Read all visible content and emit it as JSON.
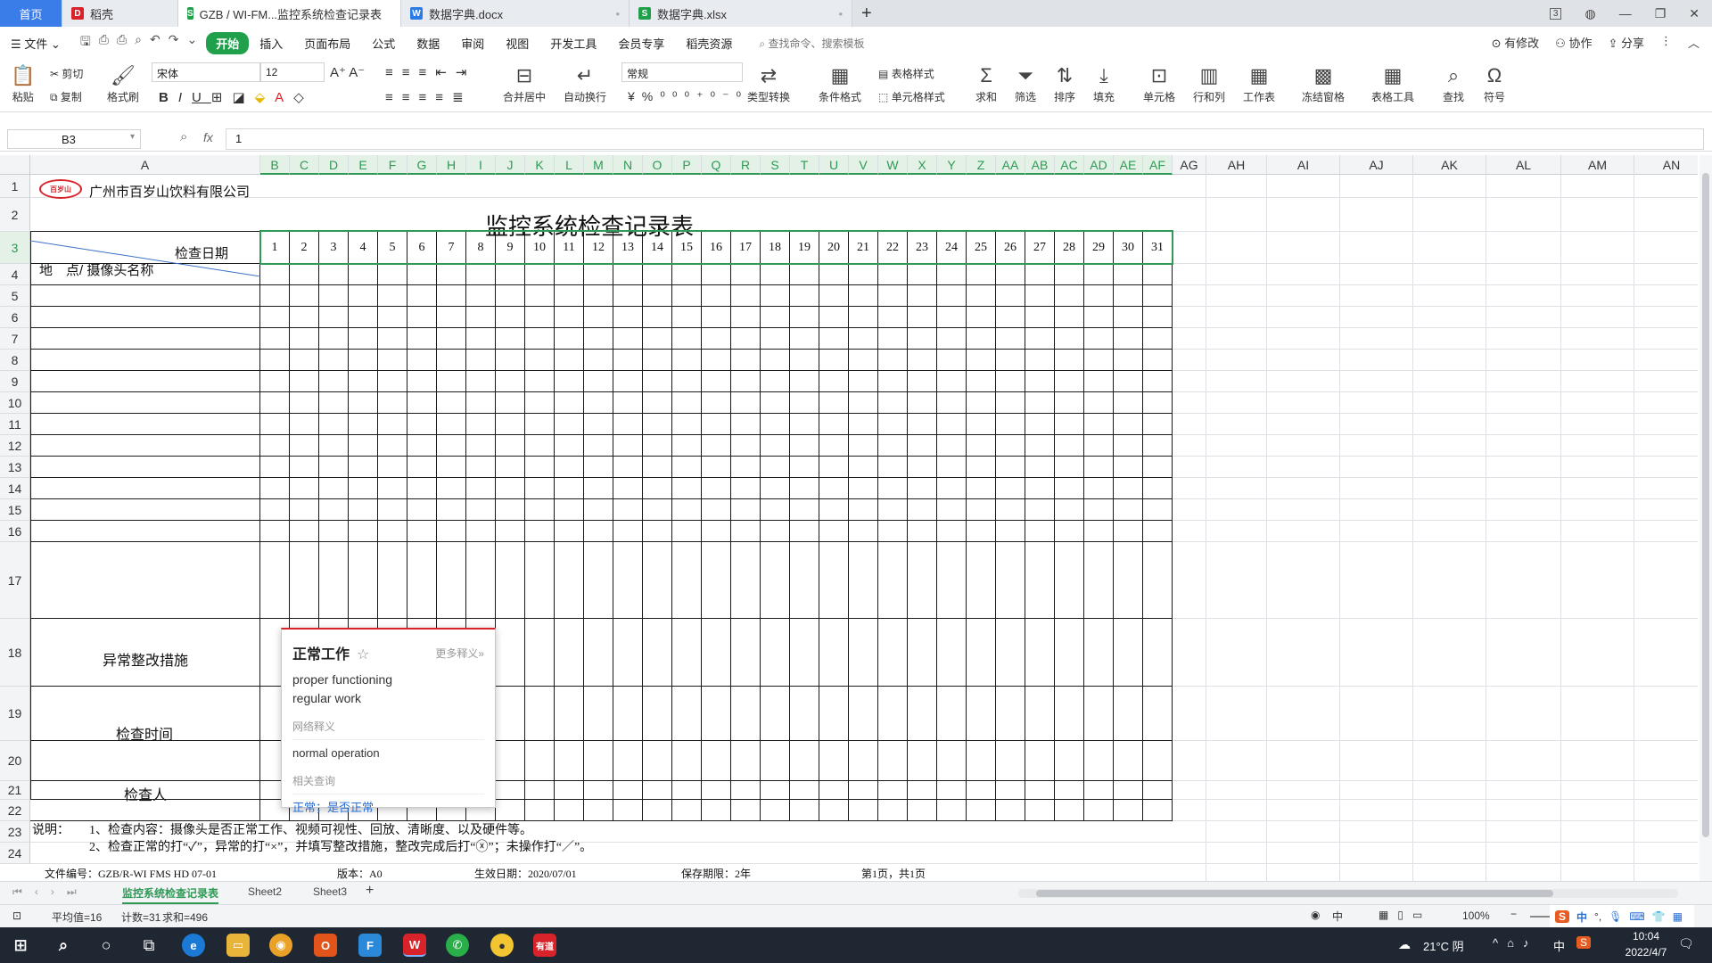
{
  "tabs": [
    {
      "label": "首页",
      "type": "home"
    },
    {
      "label": "稻壳",
      "icon": "docer-icon",
      "color": "#d8232a"
    },
    {
      "label": "GZB / WI-FM...监控系统检查记录表",
      "icon": "sheet-icon",
      "color": "#20a04a",
      "active": true
    },
    {
      "label": "数据字典.docx",
      "icon": "word-icon",
      "color": "#2b7be5"
    },
    {
      "label": "数据字典.xlsx",
      "icon": "sheet-icon",
      "color": "#20a04a"
    }
  ],
  "new_tab": "+",
  "window_badge": "3",
  "menu": {
    "file": "文件",
    "items": [
      "开始",
      "插入",
      "页面布局",
      "公式",
      "数据",
      "审阅",
      "视图",
      "开发工具",
      "会员专享",
      "稻壳资源"
    ],
    "active": "开始",
    "search": "查找命令、搜索模板",
    "right": [
      "有修改",
      "协作",
      "分享"
    ]
  },
  "ribbon": {
    "paste": "粘贴",
    "cut": "剪切",
    "copy": "复制",
    "format_painter": "格式刷",
    "font": "宋体",
    "font_size": "12",
    "merge": "合并居中",
    "wrap": "自动换行",
    "number_format": "常规",
    "convert": "类型转换",
    "cond_format": "条件格式",
    "table_style": "表格样式",
    "cell_style": "单元格样式",
    "sum": "求和",
    "filter": "筛选",
    "sort": "排序",
    "fill": "填充",
    "cell": "单元格",
    "rowcol": "行和列",
    "worksheet": "工作表",
    "freeze": "冻结窗格",
    "table_tools": "表格工具",
    "find": "查找",
    "symbol": "符号"
  },
  "formula_bar": {
    "cell": "B3",
    "fx": "fx",
    "value": "1"
  },
  "columns": {
    "A": "A",
    "date_cols": [
      "B",
      "C",
      "D",
      "E",
      "F",
      "G",
      "H",
      "I",
      "J",
      "K",
      "L",
      "M",
      "N",
      "O",
      "P",
      "Q",
      "R",
      "S",
      "T",
      "U",
      "V",
      "W",
      "X",
      "Y",
      "Z",
      "AA",
      "AB",
      "AC",
      "AD",
      "AE",
      "AF"
    ],
    "extra": [
      "AG",
      "AH",
      "AI",
      "AJ",
      "AK",
      "AL",
      "AM",
      "AN"
    ]
  },
  "rows": [
    "1",
    "2",
    "3",
    "4",
    "5",
    "6",
    "7",
    "8",
    "9",
    "10",
    "11",
    "12",
    "13",
    "14",
    "15",
    "16",
    "17",
    "18",
    "19",
    "20",
    "21",
    "22",
    "23",
    "24"
  ],
  "sheet": {
    "company": "广州市百岁山饮料有限公司",
    "logo_text": "百岁山",
    "title": "监控系统检查记录表",
    "header_date": "检查日期",
    "header_place": "地　点/ 摄像头名称",
    "days": [
      "1",
      "2",
      "3",
      "4",
      "5",
      "6",
      "7",
      "8",
      "9",
      "10",
      "11",
      "12",
      "13",
      "14",
      "15",
      "16",
      "17",
      "18",
      "19",
      "20",
      "21",
      "22",
      "23",
      "24",
      "25",
      "26",
      "27",
      "28",
      "29",
      "30",
      "31"
    ],
    "row20": "异常整改措施",
    "row21": "检查时间",
    "row22": "检查人",
    "note_label": "说明：",
    "note1": "1、检查内容：摄像头是否正常工作、视频可视性、回放、清晰度、以及硬件等。",
    "note2": "2、检查正常的打“✓”，异常的打“×”，并填写整改措施，整改完成后打“ⓧ”；未操作打“／”。",
    "footer": {
      "doc_no": "文件编号：GZB/R-WI FMS HD 07-01",
      "version": "版本：A0",
      "effective": "生效日期：2020/07/01",
      "retention": "保存期限：2年",
      "page": "第1页，共1页"
    }
  },
  "popup": {
    "word": "正常工作",
    "more": "更多释义»",
    "defs": [
      "proper functioning",
      "regular work"
    ],
    "net_label": "网络释义",
    "net_def": "normal operation",
    "related_label": "相关查询",
    "related": "正常；是否正常"
  },
  "sheets": [
    "监控系统检查记录表",
    "Sheet2",
    "Sheet3"
  ],
  "status": {
    "avg": "平均值=16",
    "count": "计数=31",
    "sum": "求和=496",
    "zoom": "100%"
  },
  "taskbar": {
    "weather": "21°C 阴",
    "time": "10:04",
    "date": "2022/4/7",
    "ime": "中"
  }
}
